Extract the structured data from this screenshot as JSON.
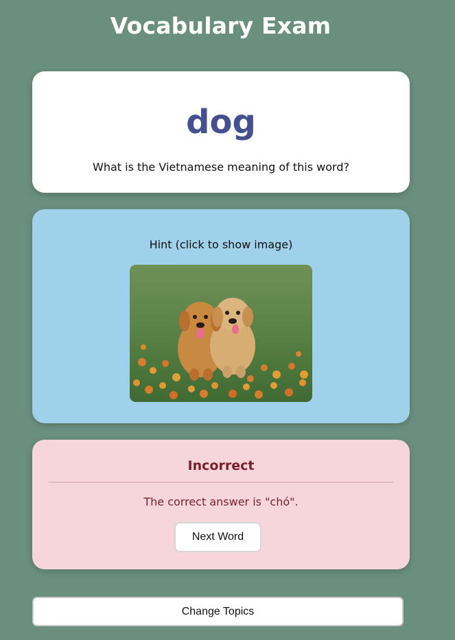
{
  "header": {
    "title": "Vocabulary Exam"
  },
  "word_card": {
    "word": "dog",
    "question": "What is the Vietnamese meaning of this word?"
  },
  "hint_card": {
    "label": "Hint (click to show image)",
    "image_icon": "puppies-image"
  },
  "result_card": {
    "title": "Incorrect",
    "message": "The correct answer is \"chó\".",
    "next_label": "Next Word"
  },
  "footer": {
    "change_topics_label": "Change Topics"
  },
  "colors": {
    "background": "#6b8f7f",
    "word": "#44508f",
    "hint_bg": "#a0d1ea",
    "result_bg": "#f6d6da",
    "result_text": "#7a1f2c"
  }
}
